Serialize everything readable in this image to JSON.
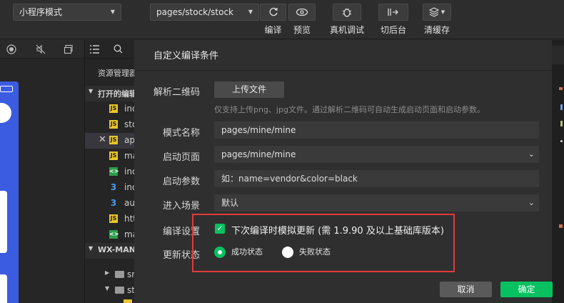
{
  "toolbar": {
    "mode_select": "小程序模式",
    "page_select": "pages/stock/stock",
    "compile_label": "编译",
    "preview_label": "预览",
    "remote_debug_label": "真机调试",
    "background_label": "切后台",
    "clear_cache_label": "清缓存"
  },
  "explorer": {
    "title": "资源管理器",
    "open_editors": "打开的编辑器",
    "project": "WX-MANAGER",
    "files": [
      {
        "name": "index",
        "icon": "JS"
      },
      {
        "name": "stock",
        "icon": "JS"
      },
      {
        "name": "app.js",
        "icon": "JS"
      },
      {
        "name": "main.js",
        "icon": "JS"
      },
      {
        "name": "index.wxml",
        "icon": "<>"
      },
      {
        "name": "index.wxss",
        "icon": "3"
      },
      {
        "name": "auth.wxss",
        "icon": "3"
      },
      {
        "name": "http.js",
        "icon": "JS"
      },
      {
        "name": "main.wxml",
        "icon": "<>"
      }
    ],
    "folders": [
      {
        "name": "src"
      },
      {
        "name": "static"
      }
    ]
  },
  "dialog": {
    "title": "自定义编译条件",
    "qr_label": "解析二维码",
    "upload_button": "上传文件",
    "upload_hint": "仅支持上传png、jpg文件。通过解析二维码可自动生成启动页面和启动参数。",
    "mode_name_label": "模式名称",
    "mode_name_value": "pages/mine/mine",
    "start_page_label": "启动页面",
    "start_page_value": "pages/mine/mine",
    "start_params_label": "启动参数",
    "start_params_placeholder": "如：name=vendor&color=black",
    "scene_label": "进入场景",
    "scene_value": "默认",
    "compile_settings_label": "编译设置",
    "compile_checkbox_label": "下次编译时模拟更新 (需 1.9.90 及以上基础库版本)",
    "update_status_label": "更新状态",
    "status_success": "成功状态",
    "status_fail": "失败状态",
    "cancel_button": "取消",
    "confirm_button": "确定"
  },
  "colors": {
    "accent_green": "#07c160",
    "highlight_red": "#e03a3a"
  }
}
